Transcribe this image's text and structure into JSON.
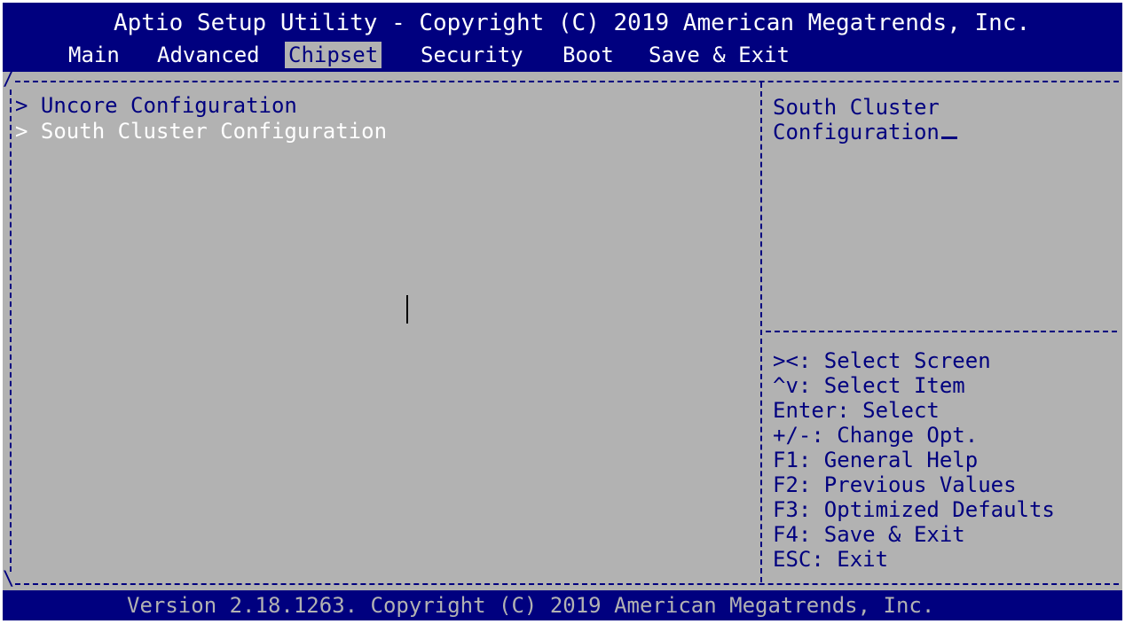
{
  "header": {
    "title": "Aptio Setup Utility - Copyright (C) 2019 American Megatrends, Inc.",
    "tabs": [
      {
        "label": "Main",
        "active": false
      },
      {
        "label": "Advanced",
        "active": false
      },
      {
        "label": "Chipset",
        "active": true
      },
      {
        "label": "Security",
        "active": false
      },
      {
        "label": "Boot",
        "active": false
      },
      {
        "label": "Save & Exit",
        "active": false
      }
    ]
  },
  "menu": {
    "items": [
      {
        "label": "> Uncore Configuration",
        "selected": false
      },
      {
        "label": "> South Cluster Configuration",
        "selected": true
      }
    ]
  },
  "help": {
    "lines": [
      "South Cluster",
      "Configuration"
    ]
  },
  "keys": [
    "><: Select Screen",
    "^v: Select Item",
    "Enter: Select",
    "+/-: Change Opt.",
    "F1: General Help",
    "F2: Previous Values",
    "F3: Optimized Defaults",
    "F4: Save & Exit",
    "ESC: Exit"
  ],
  "footer": {
    "text": "Version 2.18.1263. Copyright (C) 2019 American Megatrends, Inc."
  },
  "colors": {
    "background": "#b2b2b2",
    "bar": "#00007f",
    "text": "#00007f",
    "highlight": "#ffffff"
  }
}
